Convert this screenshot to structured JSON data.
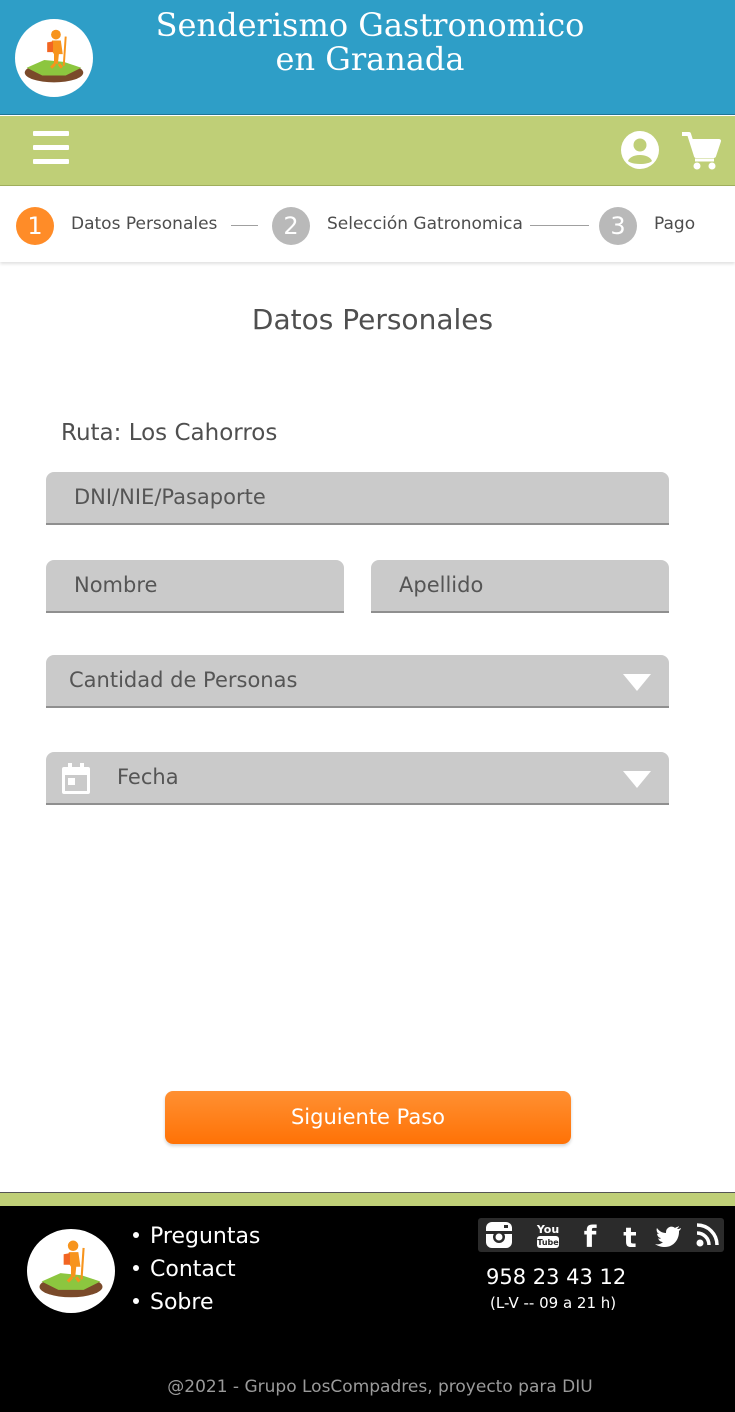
{
  "header": {
    "title_line1": "Senderismo Gastronomico",
    "title_line2": "en Granada"
  },
  "nav": {
    "menu_icon": "hamburger-menu-icon",
    "account_icon": "account-circle-icon",
    "cart_icon": "shopping-cart-icon"
  },
  "stepper": {
    "steps": [
      {
        "number": "1",
        "label": "Datos Personales",
        "state": "active"
      },
      {
        "number": "2",
        "label": "Selección Gatronomica",
        "state": "inactive"
      },
      {
        "number": "3",
        "label": "Pago",
        "state": "inactive"
      }
    ]
  },
  "form": {
    "title": "Datos Personales",
    "route": "Ruta: Los Cahorros",
    "dni_placeholder": "DNI/NIE/Pasaporte",
    "nombre_placeholder": "Nombre",
    "apellido_placeholder": "Apellido",
    "personas_placeholder": "Cantidad de Personas",
    "fecha_placeholder": "Fecha",
    "next_button": "Siguiente Paso"
  },
  "footer": {
    "links": [
      "Preguntas",
      "Contact",
      "Sobre"
    ],
    "social": [
      "instagram-icon",
      "youtube-icon",
      "facebook-icon",
      "tumblr-icon",
      "twitter-icon",
      "rss-icon"
    ],
    "phone": "958 23 43 12",
    "hours": "(L-V -- 09 a 21 h)",
    "copyright": "@2021 - Grupo LosCompadres, proyecto para DIU"
  },
  "colors": {
    "header_blue": "#2e9ec7",
    "nav_green": "#bfcf77",
    "accent_orange": "#ff8c28",
    "field_gray": "#cacaca",
    "footer_black": "#000000"
  }
}
